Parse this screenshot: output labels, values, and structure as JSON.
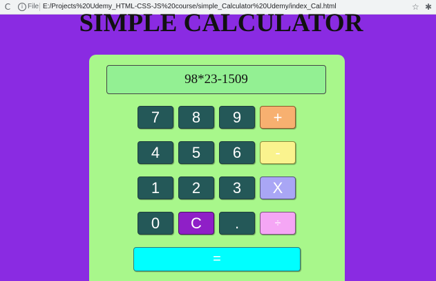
{
  "browser": {
    "back_icon": "C",
    "info_icon": "i",
    "scheme": "File",
    "url": "E:/Projects%20Udemy_HTML-CSS-JS%20course/simple_Calculator%20Udemy/index_Cal.html",
    "star_icon": "☆",
    "extensions_icon": "✱"
  },
  "page": {
    "title": "SIMPLE CALCULATOR"
  },
  "calculator": {
    "display_value": "98*23-1509",
    "keys": {
      "k7": "7",
      "k8": "8",
      "k9": "9",
      "plus": "+",
      "k4": "4",
      "k5": "5",
      "k6": "6",
      "minus": "-",
      "k1": "1",
      "k2": "2",
      "k3": "3",
      "times": "X",
      "k0": "0",
      "clear": "C",
      "dot": ".",
      "divide": "÷",
      "equals": "="
    }
  },
  "colors": {
    "page_background": "#8a2be2",
    "calculator_background": "#a8f78b",
    "display_background": "#93f093",
    "number_key": "#245858",
    "plus_key": "#f7b070",
    "minus_key": "#faf38e",
    "times_key": "#a9a6f5",
    "divide_key": "#f5a6f5",
    "clear_key": "#8f1fc7",
    "equals_key": "#00ffff"
  }
}
